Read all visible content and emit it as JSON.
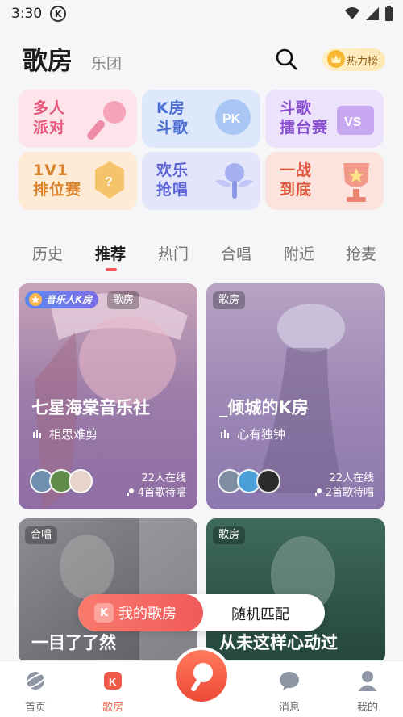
{
  "status_bar": {
    "time": "3:30",
    "badge": "K"
  },
  "header": {
    "title": "歌房",
    "subtitle": "乐团",
    "hot_label": "热力榜"
  },
  "tiles": [
    {
      "line1": "多人",
      "line2": "派对",
      "color": "#e6567a",
      "bg": "#fde3ea"
    },
    {
      "line1": "K房",
      "line2": "斗歌",
      "color": "#4b6fd3",
      "bg": "#dde9fb"
    },
    {
      "line1": "斗歌",
      "line2": "擂台赛",
      "color": "#8a4fd0",
      "bg": "#ece2fb"
    },
    {
      "line1": "1V1",
      "line2": "排位赛",
      "color": "#d9822b",
      "bg": "#fdebd5"
    },
    {
      "line1": "欢乐",
      "line2": "抢唱",
      "color": "#5b63d6",
      "bg": "#e3e6fb"
    },
    {
      "line1": "一战",
      "line2": "到底",
      "color": "#e0573f",
      "bg": "#fde3dd"
    }
  ],
  "tabs": [
    "历史",
    "推荐",
    "热门",
    "合唱",
    "附近",
    "抢麦"
  ],
  "active_tab": "推荐",
  "cards": [
    {
      "vip_label": "音乐人K房",
      "tag": "歌房",
      "name": "七星海棠音乐社",
      "song": "相思难剪",
      "online": "22人在线",
      "queue": "4首歌待唱"
    },
    {
      "tag": "歌房",
      "name": "_倾城的K房",
      "song": "心有独钟",
      "online": "22人在线",
      "queue": "2首歌待唱"
    },
    {
      "tag": "合唱",
      "name": "一目了了然"
    },
    {
      "tag": "歌房",
      "name": "从未这样心动过"
    }
  ],
  "floating": {
    "my_room": "我的歌房",
    "k_badge": "K",
    "random": "随机匹配"
  },
  "nav": {
    "home": "首页",
    "rooms": "歌房",
    "messages": "消息",
    "me": "我的"
  },
  "colors": {
    "accent": "#ef5a4a"
  }
}
